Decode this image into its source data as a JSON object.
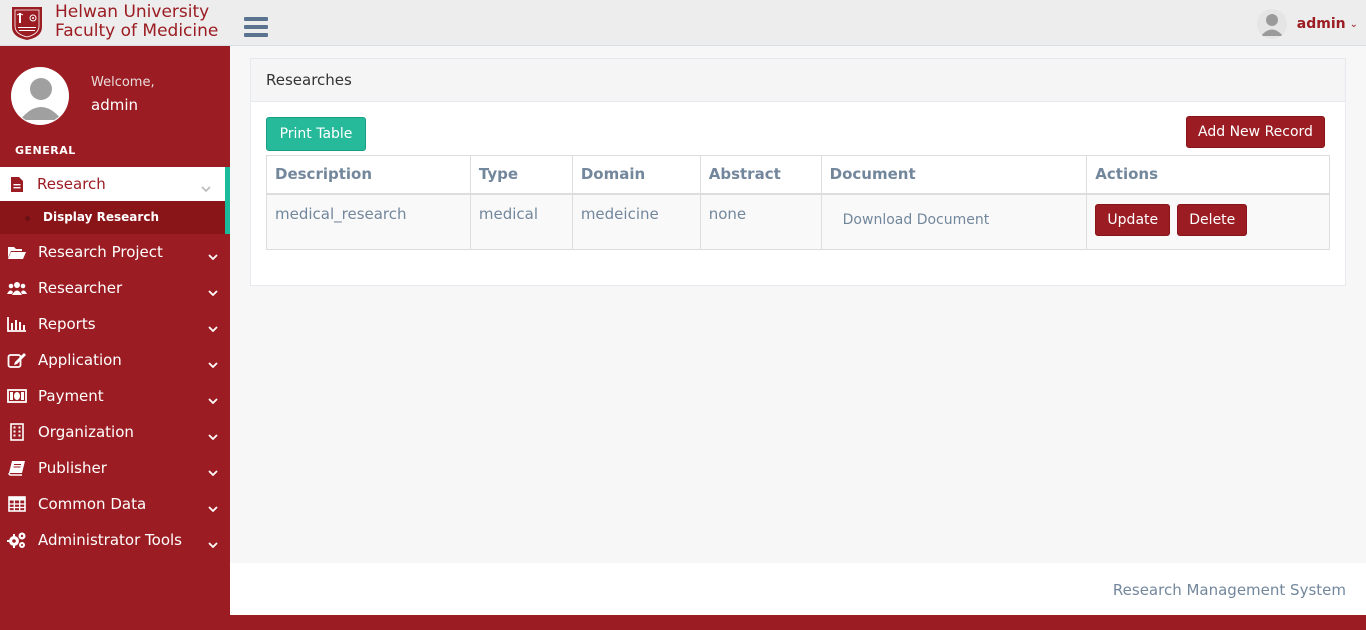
{
  "brand": {
    "line1": "Helwan University",
    "line2": "Faculty of Medicine"
  },
  "header": {
    "user_name": "admin"
  },
  "sidebar": {
    "welcome": "Welcome,",
    "user_name": "admin",
    "section_title": "GENERAL",
    "active_item": {
      "label": "Research",
      "icon": "document-icon"
    },
    "sub_item": {
      "label": "Display Research"
    },
    "items": [
      {
        "label": "Research Project",
        "icon": "folder-open-icon"
      },
      {
        "label": "Researcher",
        "icon": "users-icon"
      },
      {
        "label": "Reports",
        "icon": "bar-chart-icon"
      },
      {
        "label": "Application",
        "icon": "edit-icon"
      },
      {
        "label": "Payment",
        "icon": "money-icon"
      },
      {
        "label": "Organization",
        "icon": "building-icon"
      },
      {
        "label": "Publisher",
        "icon": "book-icon"
      },
      {
        "label": "Common Data",
        "icon": "table-icon"
      },
      {
        "label": "Administrator Tools",
        "icon": "cogs-icon"
      }
    ]
  },
  "main": {
    "panel_title": "Researches",
    "print_label": "Print Table",
    "add_label": "Add New Record",
    "table": {
      "columns": [
        "Description",
        "Type",
        "Domain",
        "Abstract",
        "Document",
        "Actions"
      ],
      "rows": [
        {
          "description": "medical_research",
          "type": "medical",
          "domain": "medeicine",
          "abstract": "none",
          "document": "Download Document",
          "update": "Update",
          "delete": "Delete"
        }
      ]
    }
  },
  "footer": {
    "text": "Research Management System"
  },
  "colors": {
    "primary": "#9b1c22",
    "accent": "#26b99a",
    "text": "#73879c"
  }
}
